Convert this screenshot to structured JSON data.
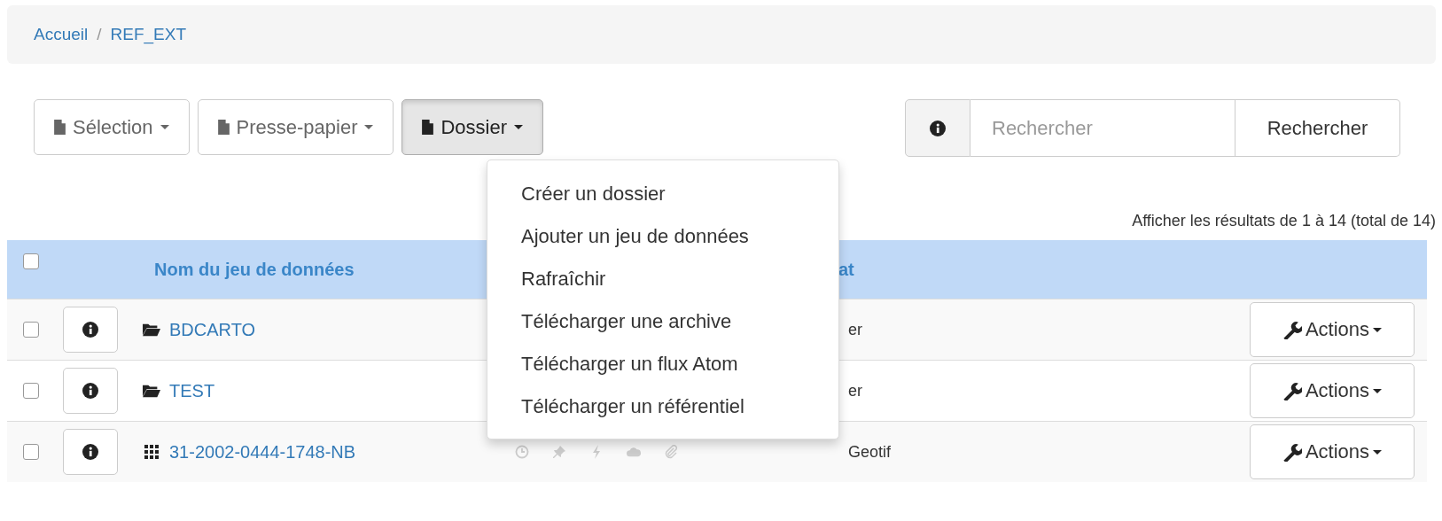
{
  "breadcrumb": [
    {
      "label": "Accueil"
    },
    {
      "label": "REF_EXT"
    }
  ],
  "breadcrumb_separator": "/",
  "toolbar": {
    "buttons": [
      {
        "label": "Sélection",
        "open": false
      },
      {
        "label": "Presse-papier",
        "open": false
      },
      {
        "label": "Dossier",
        "open": true
      }
    ],
    "dropdown": [
      "Créer un dossier",
      "Ajouter un jeu de données",
      "Rafraîchir",
      "Télécharger une archive",
      "Télécharger un flux Atom",
      "Télécharger un référentiel"
    ],
    "search": {
      "placeholder": "Rechercher",
      "button": "Rechercher"
    }
  },
  "results_text": "Afficher les résultats de 1 à 14 (total de 14)",
  "table": {
    "select_all": {
      "checked": false
    },
    "columns": [
      "Nom du jeu de données",
      "at"
    ],
    "rows": [
      {
        "checked": false,
        "kind": "folder",
        "name": "BDCARTO",
        "status_icons": false,
        "format": "er",
        "action": "Actions"
      },
      {
        "checked": false,
        "kind": "folder",
        "name": "TEST",
        "status_icons": false,
        "format": "er",
        "action": "Actions"
      },
      {
        "checked": false,
        "kind": "dataset",
        "name": "31-2002-0444-1748-NB",
        "status_icons": true,
        "format": "Geotif",
        "action": "Actions"
      }
    ]
  }
}
